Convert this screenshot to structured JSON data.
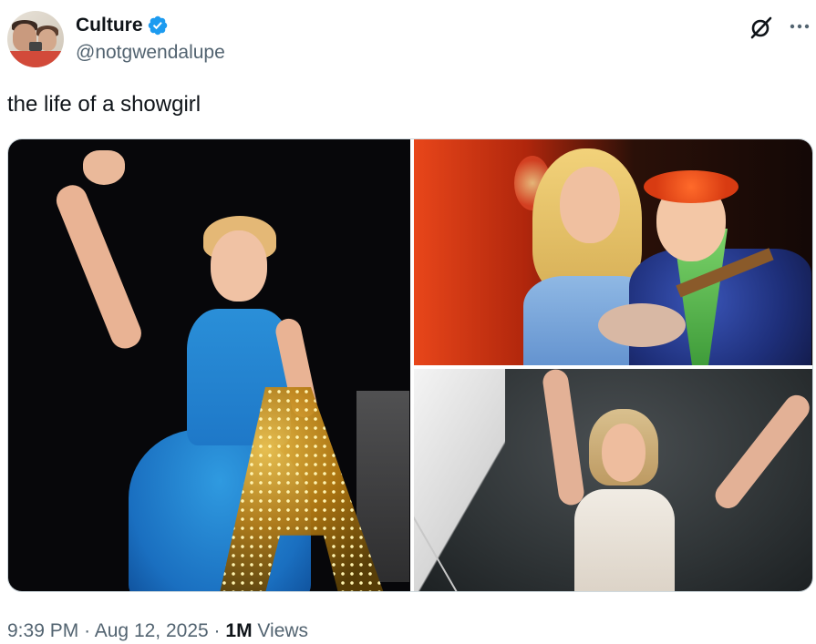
{
  "author": {
    "display_name": "Culture",
    "handle": "@notgwendalupe",
    "verified": true,
    "avatar_icon": "profile-photo-two-people"
  },
  "actions": {
    "grok_icon": "grok-icon",
    "more_icon": "more-horizontal-icon"
  },
  "tweet": {
    "text": "the life of a showgirl"
  },
  "media": {
    "count": 3,
    "images": [
      {
        "name": "showgirl-blue-dress-waving"
      },
      {
        "name": "hawaiian-duet-ukulele"
      },
      {
        "name": "showgirl-white-fringe-arms-raised"
      }
    ]
  },
  "meta": {
    "time": "9:39 PM",
    "separator": "·",
    "date": "Aug 12, 2025",
    "views_count": "1M",
    "views_label": "Views"
  },
  "colors": {
    "text_primary": "#0f1419",
    "text_secondary": "#536471",
    "verified_blue": "#1d9bf0",
    "border": "#cfd9de"
  }
}
